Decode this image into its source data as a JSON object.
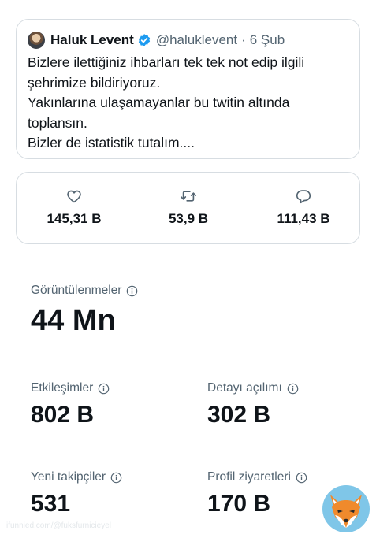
{
  "tweet": {
    "author_name": "Haluk Levent",
    "handle": "@haluklevent",
    "separator": "·",
    "date": "6 Şub",
    "lines": [
      "Bizlere ilettiğiniz ihbarları tek tek not edip ilgili",
      "şehrimize bildiriyoruz.",
      "Yakınlarına ulaşamayanlar bu twitin altında",
      "toplansın.",
      "Bizler de istatistik tutalım...."
    ]
  },
  "engagement": {
    "likes": {
      "icon": "heart-icon",
      "count": "145,31 B"
    },
    "retweets": {
      "icon": "retweet-icon",
      "count": "53,9 B"
    },
    "replies": {
      "icon": "reply-icon",
      "count": "111,43 B"
    }
  },
  "metrics": {
    "views": {
      "label": "Görüntülenmeler",
      "value": "44 Mn"
    },
    "engagements": {
      "label": "Etkileşimler",
      "value": "802 B"
    },
    "detail_expands": {
      "label": "Detayı açılımı",
      "value": "302 B"
    },
    "new_followers": {
      "label": "Yeni takipçiler",
      "value": "531"
    },
    "profile_visits": {
      "label": "Profil ziyaretleri",
      "value": "170 B"
    }
  },
  "colors": {
    "verified": "#1d9bf0",
    "secondary_text": "#536471",
    "border": "#d7dde2"
  },
  "credit": "ifunnied.com/@fuksfurnicieyel"
}
